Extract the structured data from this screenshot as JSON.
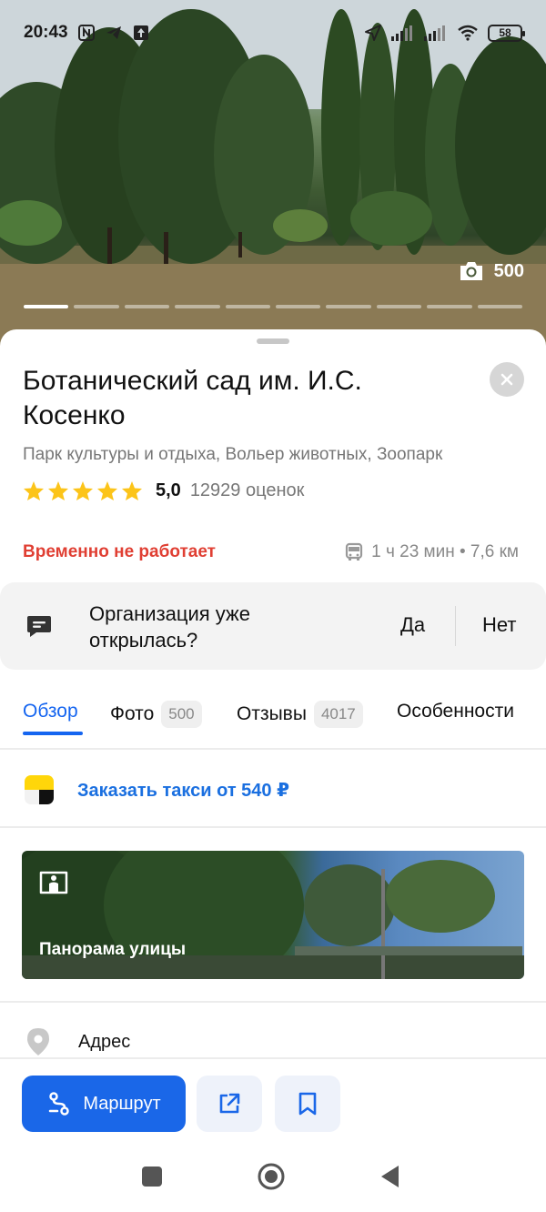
{
  "status_bar": {
    "time": "20:43",
    "battery": "58",
    "icons": [
      "nfc-icon",
      "telegram-icon",
      "upload-icon",
      "location-arrow-icon",
      "signal-icon",
      "signal-icon",
      "wifi-icon",
      "battery-icon"
    ]
  },
  "hero": {
    "photo_count": "500",
    "photo_segments": 10,
    "active_segment": 1
  },
  "place": {
    "title": "Ботанический сад им. И.С. Косенко",
    "categories": "Парк культуры и отдыха, Вольер животных, Зоопарк",
    "rating_value": "5,0",
    "rating_count": "12929 оценок",
    "stars": 5,
    "status": "Временно не работает",
    "travel": "1 ч 23 мин • 7,6 км"
  },
  "opened_prompt": {
    "question": "Организация уже открылась?",
    "yes": "Да",
    "no": "Нет"
  },
  "tabs": [
    {
      "label": "Обзор",
      "badge": ""
    },
    {
      "label": "Фото",
      "badge": "500"
    },
    {
      "label": "Отзывы",
      "badge": "4017"
    },
    {
      "label": "Особенности",
      "badge": ""
    }
  ],
  "taxi": {
    "label": "Заказать такси от 540 ₽"
  },
  "panorama": {
    "label": "Панорама улицы"
  },
  "address": {
    "label": "Адрес"
  },
  "actions": {
    "route_label": "Маршрут"
  },
  "colors": {
    "accent": "#1565f0",
    "route_button": "#1a67e8",
    "closed_status": "#e03f33",
    "star": "#fcc419",
    "taxi_yellow": "#ffd60a"
  }
}
